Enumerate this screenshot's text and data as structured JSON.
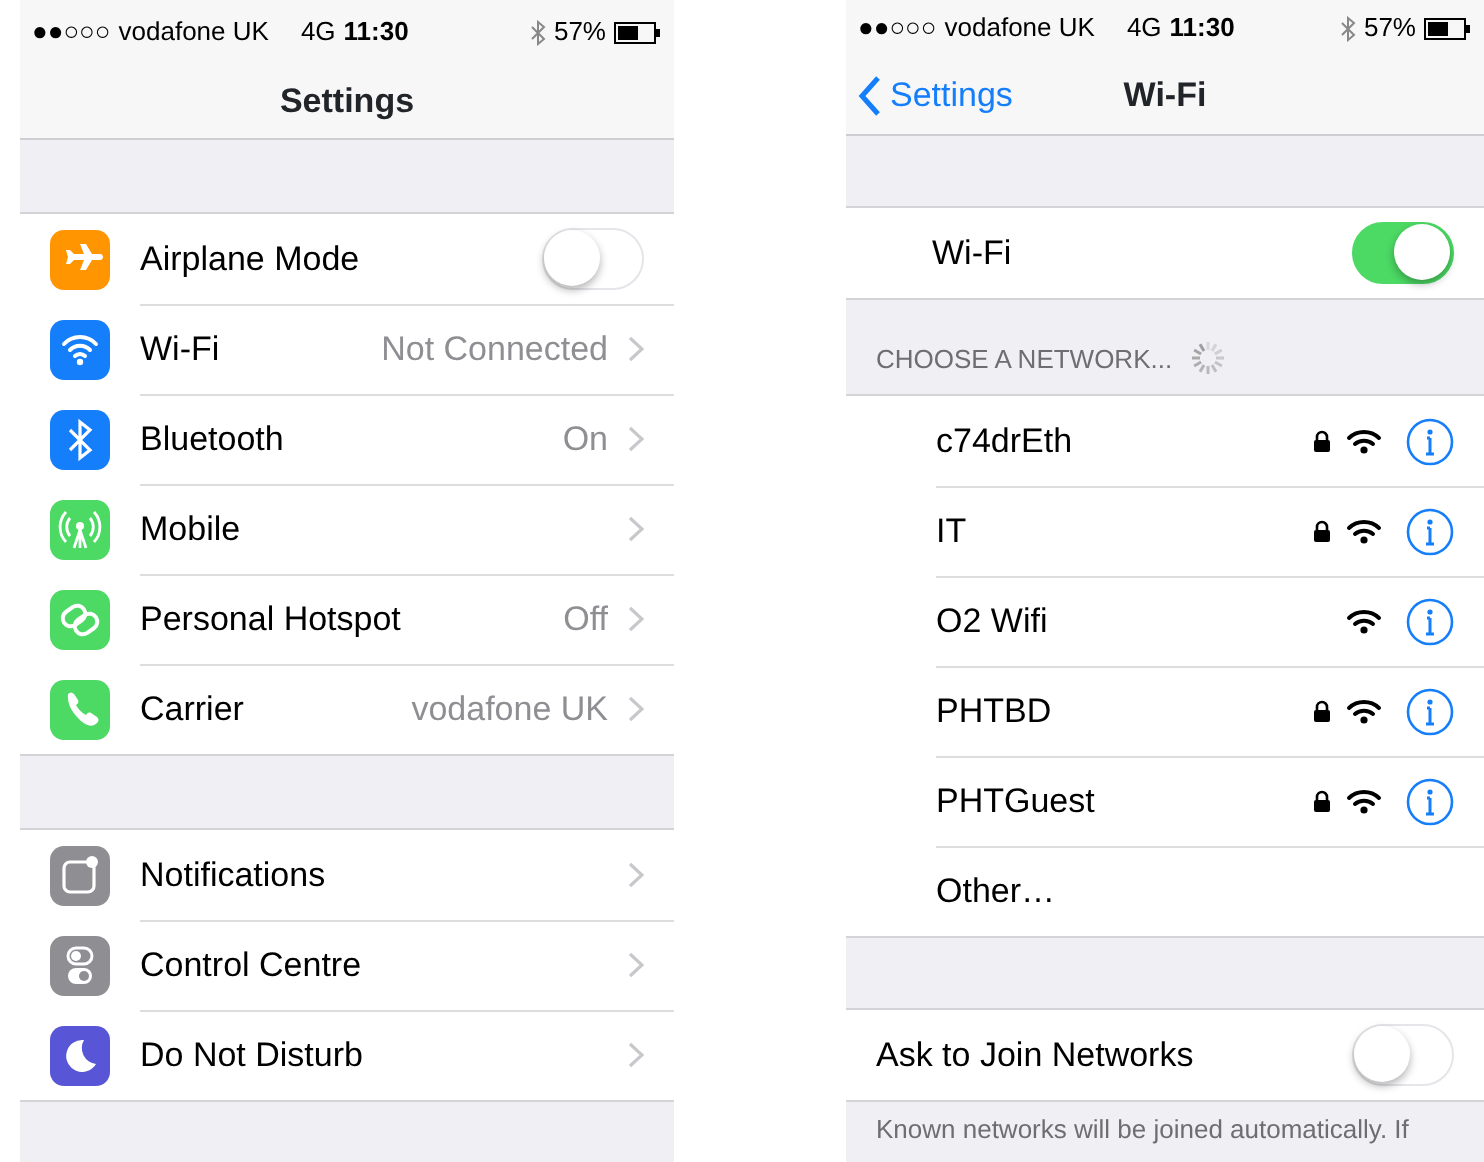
{
  "settings_screen": {
    "status_bar": {
      "signal": "●●○○○",
      "carrier": "vodafone UK",
      "network": "4G",
      "time": "11:30",
      "battery": "57%"
    },
    "title": "Settings",
    "groups": [
      {
        "rows": [
          {
            "kind": "toggle",
            "label": "Airplane Mode",
            "color": "#ff9500",
            "on": false
          },
          {
            "kind": "link",
            "label": "Wi-Fi",
            "value": "Not Connected",
            "color": "#147efb"
          },
          {
            "kind": "link",
            "label": "Bluetooth",
            "value": "On",
            "color": "#147efb"
          },
          {
            "kind": "link",
            "label": "Mobile",
            "color": "#4cd964"
          },
          {
            "kind": "link",
            "label": "Personal Hotspot",
            "value": "Off",
            "color": "#4cd964"
          },
          {
            "kind": "link",
            "label": "Carrier",
            "value": "vodafone UK",
            "color": "#4cd964"
          }
        ]
      },
      {
        "rows": [
          {
            "kind": "link",
            "label": "Notifications",
            "color": "#8e8e93"
          },
          {
            "kind": "link",
            "label": "Control Centre",
            "color": "#8e8e93"
          },
          {
            "kind": "link",
            "label": "Do Not Disturb",
            "color": "#5856d6"
          }
        ]
      }
    ]
  },
  "wifi_screen": {
    "status_bar": {
      "signal": "●●○○○",
      "carrier": "vodafone UK",
      "network": "4G",
      "time": "11:30",
      "battery": "57%"
    },
    "back": "Settings",
    "title": "Wi-Fi",
    "wifi_toggle": {
      "label": "Wi-Fi",
      "on": true
    },
    "section_header": "CHOOSE A NETWORK...",
    "networks": [
      {
        "kind": "network",
        "name": "c74drEth",
        "locked": true
      },
      {
        "kind": "network",
        "name": "IT",
        "locked": true
      },
      {
        "kind": "network",
        "name": "O2 Wifi",
        "locked": false
      },
      {
        "kind": "network",
        "name": "PHTBD",
        "locked": true
      },
      {
        "kind": "network",
        "name": "PHTGuest",
        "locked": true
      },
      {
        "kind": "other",
        "name": "Other…"
      }
    ],
    "ask_to_join": {
      "label": "Ask to Join Networks",
      "on": false
    },
    "footnote": "Known networks will be joined automatically. If"
  }
}
